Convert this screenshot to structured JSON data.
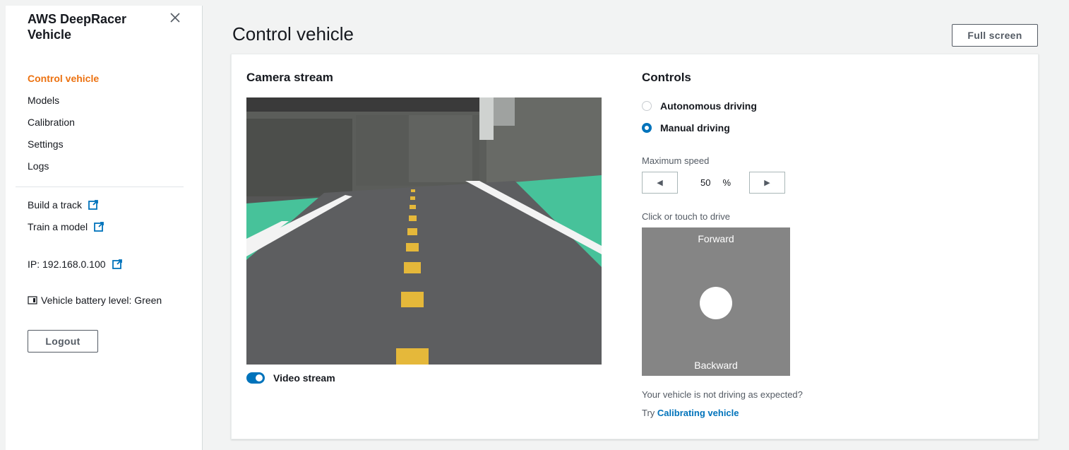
{
  "sidebar": {
    "title": "AWS DeepRacer Vehicle",
    "nav_items": [
      {
        "label": "Control vehicle",
        "active": true
      },
      {
        "label": "Models"
      },
      {
        "label": "Calibration"
      },
      {
        "label": "Settings"
      },
      {
        "label": "Logs"
      }
    ],
    "links": {
      "build_track": "Build a track",
      "train_model": "Train a model",
      "ip": "IP: 192.168.0.100"
    },
    "battery": "Vehicle battery level: Green",
    "logout_label": "Logout"
  },
  "header": {
    "title": "Control vehicle",
    "fullscreen_label": "Full screen"
  },
  "camera": {
    "heading": "Camera stream",
    "toggle_label": "Video stream",
    "toggle_on": true
  },
  "controls": {
    "heading": "Controls",
    "modes": [
      {
        "label": "Autonomous driving",
        "selected": false
      },
      {
        "label": "Manual driving",
        "selected": true
      }
    ],
    "max_speed_label": "Maximum speed",
    "max_speed_value": "50",
    "max_speed_unit": "%",
    "drive_label": "Click or touch to drive",
    "pad_forward": "Forward",
    "pad_backward": "Backward",
    "help_text": "Your vehicle is not driving as expected?",
    "try_prefix": "Try",
    "try_link": "Calibrating vehicle"
  },
  "colors": {
    "accent": "#ec7211",
    "link": "#0073bb",
    "track_green": "#47c29a"
  }
}
